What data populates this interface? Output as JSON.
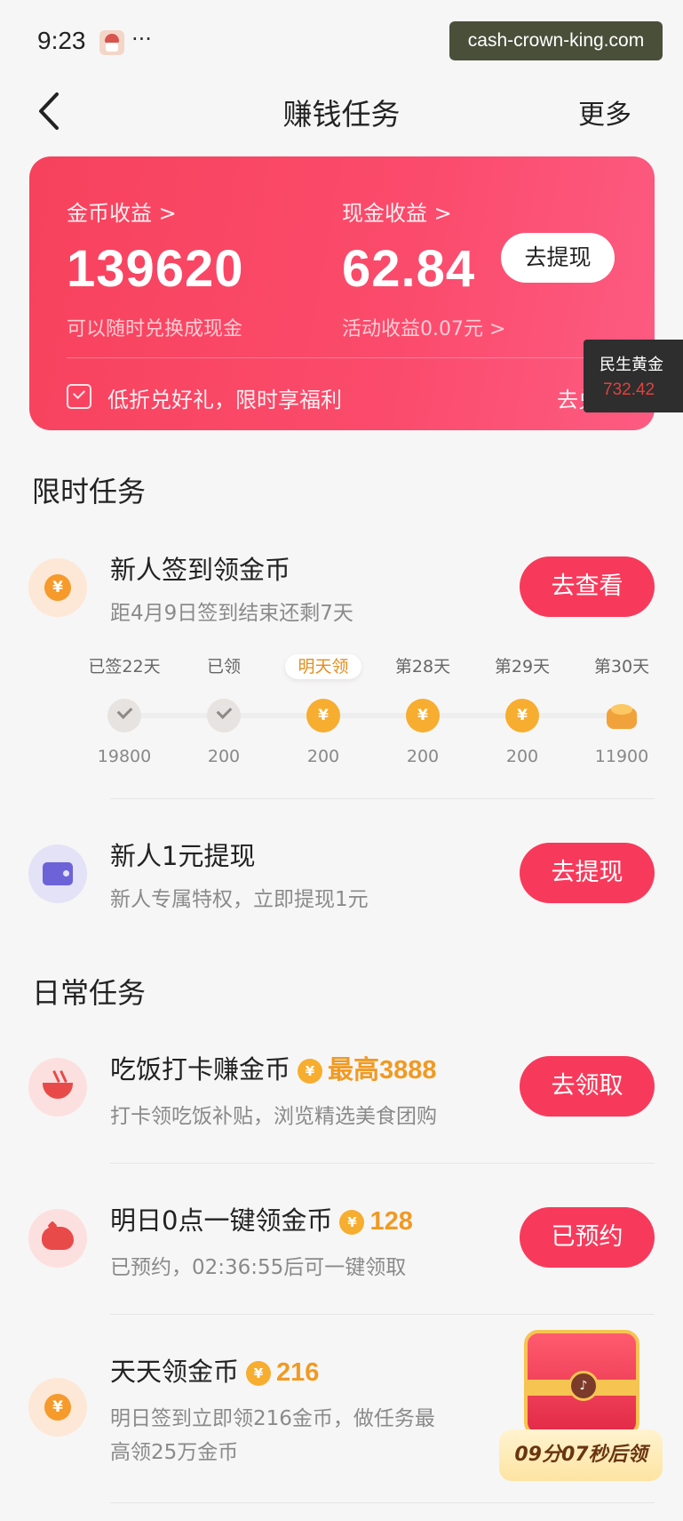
{
  "status_bar": {
    "time": "9:23",
    "dots": "···"
  },
  "watermark": "cash-crown-king.com",
  "nav": {
    "title": "赚钱任务",
    "more": "更多"
  },
  "earnings": {
    "coin_label": "金币收益 >",
    "coin_value": "139620",
    "coin_sub": "可以随时兑换成现金",
    "cash_label": "现金收益 >",
    "cash_value": "62.84",
    "cash_sub": "活动收益0.07元 >",
    "withdraw_button": "去提现",
    "gift_text": "低折兑好礼，限时享福利",
    "gift_link": "去兑换"
  },
  "gold_widget": {
    "label": "民生黄金",
    "value": "732.42"
  },
  "limited_section": {
    "title": "限时任务",
    "checkin_task": {
      "title": "新人签到领金币",
      "desc": "距4月9日签到结束还剩7天",
      "button": "去查看",
      "icon": "coin-icon"
    },
    "checkin_days": [
      {
        "label": "已签22天",
        "amount": "19800",
        "state": "done"
      },
      {
        "label": "已领",
        "amount": "200",
        "state": "done"
      },
      {
        "label": "明天领",
        "amount": "200",
        "state": "next"
      },
      {
        "label": "第28天",
        "amount": "200",
        "state": "coin"
      },
      {
        "label": "第29天",
        "amount": "200",
        "state": "coin"
      },
      {
        "label": "第30天",
        "amount": "11900",
        "state": "pile"
      }
    ],
    "withdraw_task": {
      "title": "新人1元提现",
      "desc": "新人专属特权，立即提现1元",
      "button": "去提现",
      "icon": "wallet-icon"
    }
  },
  "daily_section": {
    "title": "日常任务",
    "tasks": [
      {
        "title": "吃饭打卡赚金币",
        "reward_prefix": "最高",
        "reward": "3888",
        "desc": "打卡领吃饭补贴，浏览精选美食团购",
        "button": "去领取",
        "icon": "bowl-icon"
      },
      {
        "title": "明日0点一键领金币",
        "reward_prefix": "",
        "reward": "128",
        "desc": "已预约，02:36:55后可一键领取",
        "button": "已预约",
        "icon": "piggy-bank-icon"
      },
      {
        "title": "天天领金币",
        "reward_prefix": "",
        "reward": "216",
        "desc": "明日签到立即领216金币，做任务最",
        "desc2": "高领25万金币",
        "icon": "coin-icon"
      }
    ]
  },
  "coin_symbol": "¥",
  "treasure": {
    "timer": "09分07秒后领"
  },
  "colors": {
    "accent": "#f73a5b",
    "coin": "#f7ad2f",
    "reward": "#f09a23"
  }
}
